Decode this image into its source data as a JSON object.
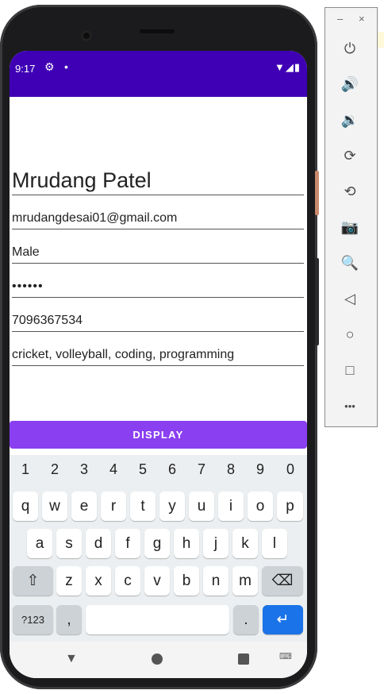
{
  "status": {
    "time": "9:17",
    "settings_icon": "gear-icon",
    "notification_dot": "•",
    "right_icons": "▼◢▮"
  },
  "form": {
    "name": "Mrudang Patel",
    "email": "mrudangdesai01@gmail.com",
    "gender": "Male",
    "password": "••••••",
    "phone": "7096367534",
    "hobbies": "cricket, volleyball, coding, programming"
  },
  "display_button": "DISPLAY",
  "keyboard": {
    "numbers": [
      "1",
      "2",
      "3",
      "4",
      "5",
      "6",
      "7",
      "8",
      "9",
      "0"
    ],
    "row1": [
      "q",
      "w",
      "e",
      "r",
      "t",
      "y",
      "u",
      "i",
      "o",
      "p"
    ],
    "row2": [
      "a",
      "s",
      "d",
      "f",
      "g",
      "h",
      "j",
      "k",
      "l"
    ],
    "row3": [
      "z",
      "x",
      "c",
      "v",
      "b",
      "n",
      "m"
    ],
    "shift": "⇧",
    "backspace": "⌫",
    "symbols": "?123",
    "comma": ",",
    "period": ".",
    "enter": "↵"
  },
  "nav": {
    "back": "▼",
    "keyboard": "⌨"
  },
  "panel": {
    "minimize": "–",
    "close": "×",
    "buttons": [
      "⏻",
      "🔊",
      "🔉",
      "⟳",
      "⟲",
      "📷",
      "🔍",
      "◁",
      "○",
      "□",
      "•••"
    ]
  },
  "colors": {
    "status_bar": "#3f00b5",
    "button": "#8a3ff0",
    "enter_key": "#1a73e8"
  }
}
